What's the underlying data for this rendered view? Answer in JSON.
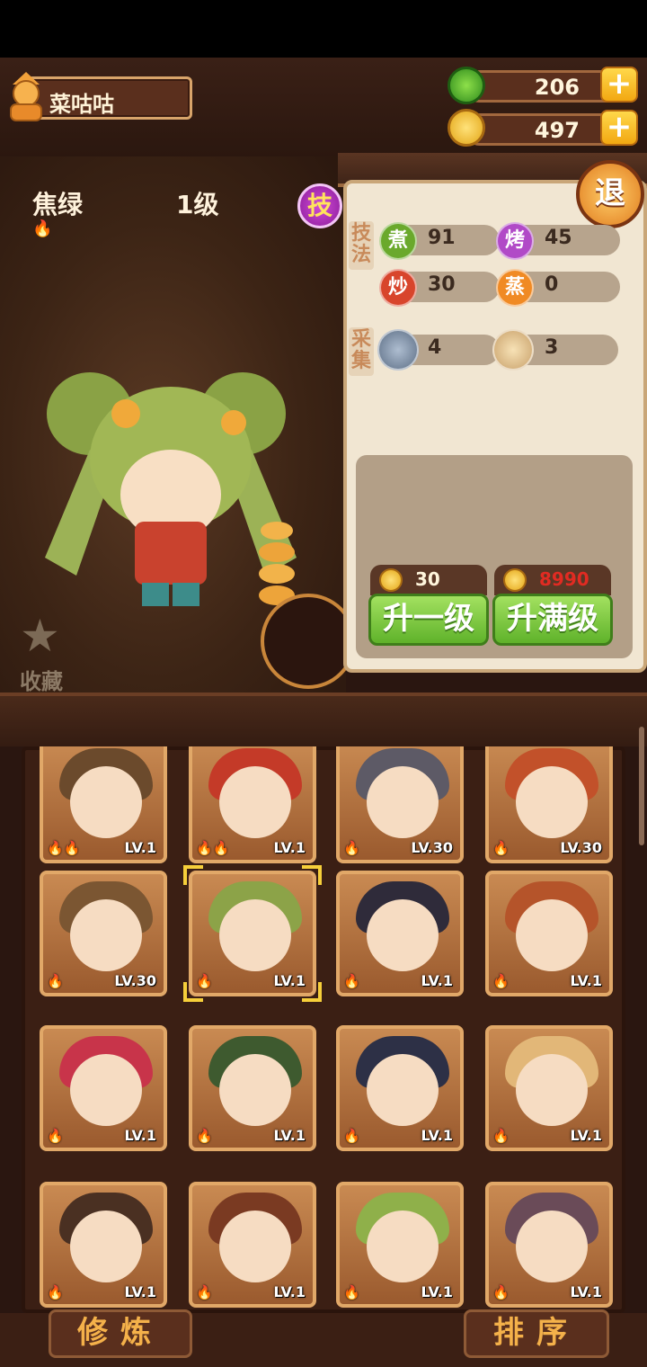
{
  "player": {
    "name": "菜咕咕"
  },
  "resources": [
    {
      "name": "jade",
      "value": "206"
    },
    {
      "name": "coins",
      "value": "497"
    }
  ],
  "chef": {
    "name": "焦绿",
    "level": "1级",
    "skill_badge": "技",
    "favorite_label": "收藏"
  },
  "retreat_label": "退",
  "panel": {
    "technique_label": "技法",
    "gather_label": "采集",
    "techniques": [
      {
        "icon": "煮",
        "value": "91",
        "color": "#6aa92c"
      },
      {
        "icon": "烤",
        "value": "45",
        "color": "#b14ac7"
      },
      {
        "icon": "炒",
        "value": "30",
        "color": "#d8452c"
      },
      {
        "icon": "蒸",
        "value": "0",
        "color": "#f08a24"
      }
    ],
    "gathers": [
      {
        "icon": "fish-icon",
        "value": "4"
      },
      {
        "icon": "bun-icon",
        "value": "3"
      }
    ],
    "upgrade_one": {
      "cost": "30",
      "label": "升一级"
    },
    "upgrade_max": {
      "cost": "8990",
      "label": "升满级"
    }
  },
  "cards": [
    {
      "lv": "LV.1",
      "flames": "🔥🔥",
      "hair": "#6b4a2c"
    },
    {
      "lv": "LV.1",
      "flames": "🔥🔥",
      "hair": "#c43a28"
    },
    {
      "lv": "LV.30",
      "flames": "🔥",
      "hair": "#5d5a66"
    },
    {
      "lv": "LV.30",
      "flames": "🔥",
      "hair": "#c2512a"
    },
    {
      "lv": "LV.30",
      "flames": "🔥",
      "hair": "#7b5632"
    },
    {
      "lv": "LV.1",
      "flames": "🔥",
      "hair": "#8ca348"
    },
    {
      "lv": "LV.1",
      "flames": "🔥",
      "hair": "#2f2b3a"
    },
    {
      "lv": "LV.1",
      "flames": "🔥",
      "hair": "#b5542a"
    },
    {
      "lv": "LV.1",
      "flames": "🔥",
      "hair": "#c8344a"
    },
    {
      "lv": "LV.1",
      "flames": "🔥",
      "hair": "#3e5a2f"
    },
    {
      "lv": "LV.1",
      "flames": "🔥",
      "hair": "#2d3046"
    },
    {
      "lv": "LV.1",
      "flames": "🔥",
      "hair": "#e2b778"
    },
    {
      "lv": "LV.1",
      "flames": "🔥",
      "hair": "#4a3022"
    },
    {
      "lv": "LV.1",
      "flames": "🔥",
      "hair": "#7a3a22"
    },
    {
      "lv": "LV.1",
      "flames": "🔥",
      "hair": "#8fb04a"
    },
    {
      "lv": "LV.1",
      "flames": "🔥",
      "hair": "#6a4b58"
    }
  ],
  "bottom": {
    "cultivate_label": "修炼",
    "sort_label": "排序"
  }
}
